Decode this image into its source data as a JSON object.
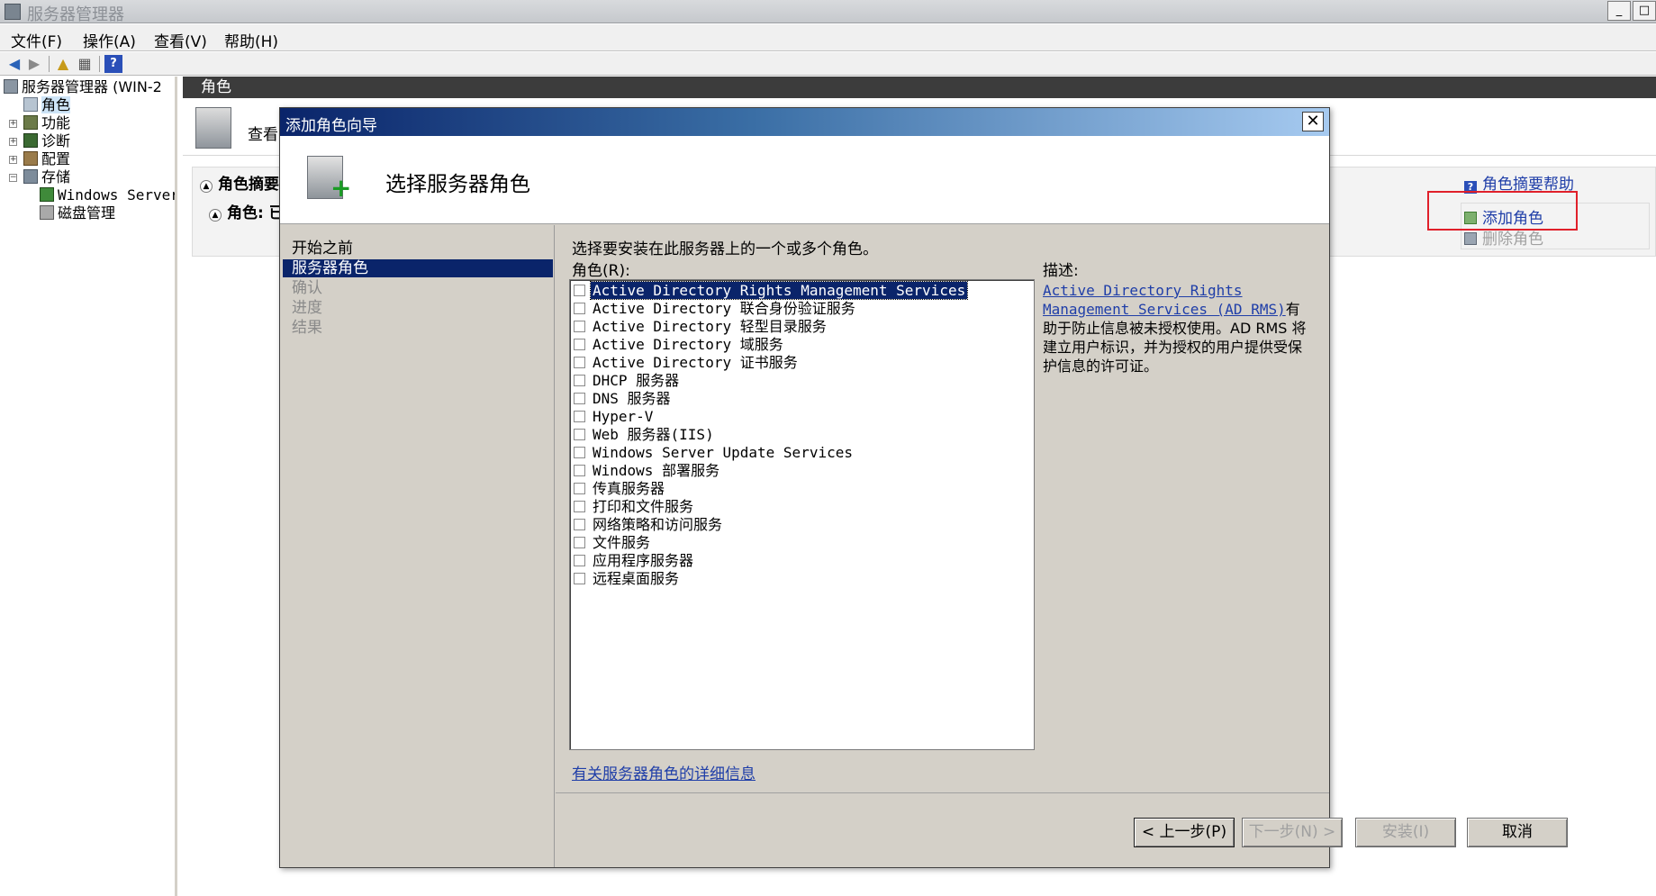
{
  "window": {
    "title": "服务器管理器",
    "controls": [
      "_",
      "□"
    ]
  },
  "menubar": {
    "items": [
      "文件(F)",
      "操作(A)",
      "查看(V)",
      "帮助(H)"
    ]
  },
  "toolbar": {
    "icons": [
      "back-icon",
      "forward-icon",
      "up-icon",
      "show-hide-tree-icon",
      "help-icon"
    ]
  },
  "tree": {
    "root": "服务器管理器 (WIN-2",
    "items": [
      "角色",
      "功能",
      "诊断",
      "配置",
      "存储"
    ],
    "storage_children": [
      "Windows Server",
      "磁盘管理"
    ]
  },
  "content": {
    "header": "角色",
    "banner_text": "查看",
    "summary_title": "角色摘要",
    "roles_line": "角色: 已",
    "actions": {
      "help": "角色摘要帮助",
      "add": "添加角色",
      "remove": "删除角色"
    }
  },
  "wizard": {
    "title": "添加角色向导",
    "close": "✕",
    "heading": "选择服务器角色",
    "steps": [
      "开始之前",
      "服务器角色",
      "确认",
      "进度",
      "结果"
    ],
    "current_step_index": 1,
    "instruction": "选择要安装在此服务器上的一个或多个角色。",
    "roles_label": "角色(R):",
    "roles": [
      "Active Directory Rights Management Services",
      "Active Directory 联合身份验证服务",
      "Active Directory 轻型目录服务",
      "Active Directory 域服务",
      "Active Directory 证书服务",
      "DHCP 服务器",
      "DNS 服务器",
      "Hyper-V",
      "Web 服务器(IIS)",
      "Windows Server Update Services",
      "Windows 部署服务",
      "传真服务器",
      "打印和文件服务",
      "网络策略和访问服务",
      "文件服务",
      "应用程序服务器",
      "远程桌面服务"
    ],
    "selected_role_index": 0,
    "description_label": "描述:",
    "description_link": "Active Directory Rights Management Services (AD RMS)",
    "description_text": "有助于防止信息被未授权使用。AD RMS 将建立用户标识，并为授权的用户提供受保护信息的许可证。",
    "more_info_link": "有关服务器角色的详细信息",
    "buttons": {
      "prev": "< 上一步(P)",
      "next": "下一步(N) >",
      "install": "安装(I)",
      "cancel": "取消"
    }
  },
  "colors": {
    "title_gradient_start": "#0a246a",
    "highlight": "#0a246a",
    "link": "#1f3ea8",
    "annotation_red": "#e0202a"
  }
}
